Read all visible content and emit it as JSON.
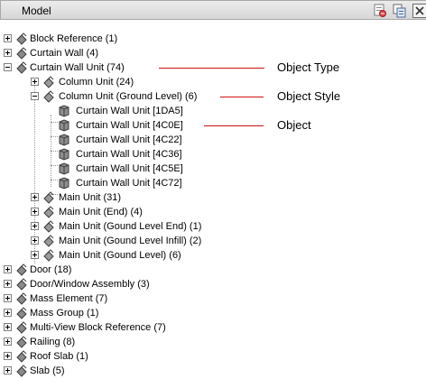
{
  "panel": {
    "title": "Model",
    "toolbar_icons": [
      "filter-icon",
      "copy-icon",
      "close-icon"
    ]
  },
  "tree": {
    "items": [
      {
        "label": "Block Reference (1)",
        "expander": "plus",
        "icon": "object-type-icon"
      },
      {
        "label": "Curtain Wall (4)",
        "expander": "plus",
        "icon": "object-type-icon"
      },
      {
        "label": "Curtain Wall Unit (74)",
        "expander": "minus",
        "icon": "object-type-icon"
      },
      {
        "label": "Column Unit (24)",
        "expander": "plus",
        "icon": "object-style-icon"
      },
      {
        "label": "Column Unit (Ground Level) (6)",
        "expander": "minus",
        "icon": "object-style-icon"
      },
      {
        "label": "Curtain Wall Unit [1DA5]",
        "icon": "object-icon"
      },
      {
        "label": "Curtain Wall Unit [4C0E]",
        "icon": "object-icon"
      },
      {
        "label": "Curtain Wall Unit [4C22]",
        "icon": "object-icon"
      },
      {
        "label": "Curtain Wall Unit [4C36]",
        "icon": "object-icon"
      },
      {
        "label": "Curtain Wall Unit [4C5E]",
        "icon": "object-icon"
      },
      {
        "label": "Curtain Wall Unit [4C72]",
        "icon": "object-icon"
      },
      {
        "label": "Main Unit (31)",
        "expander": "plus",
        "icon": "object-style-icon"
      },
      {
        "label": "Main Unit (End) (4)",
        "expander": "plus",
        "icon": "object-style-icon"
      },
      {
        "label": "Main Unit (Gound Level End) (1)",
        "expander": "plus",
        "icon": "object-style-icon"
      },
      {
        "label": "Main Unit (Gound Level Infill) (2)",
        "expander": "plus",
        "icon": "object-style-icon"
      },
      {
        "label": "Main Unit (Gound Level) (6)",
        "expander": "plus",
        "icon": "object-style-icon"
      },
      {
        "label": "Door (18)",
        "expander": "plus",
        "icon": "object-type-icon"
      },
      {
        "label": "Door/Window Assembly (3)",
        "expander": "plus",
        "icon": "object-type-icon"
      },
      {
        "label": "Mass Element (7)",
        "expander": "plus",
        "icon": "object-type-icon"
      },
      {
        "label": "Mass Group (1)",
        "expander": "plus",
        "icon": "object-type-icon"
      },
      {
        "label": "Multi-View Block Reference (7)",
        "expander": "plus",
        "icon": "object-type-icon"
      },
      {
        "label": "Railing (8)",
        "expander": "plus",
        "icon": "object-type-icon"
      },
      {
        "label": "Roof Slab (1)",
        "expander": "plus",
        "icon": "object-type-icon"
      },
      {
        "label": "Slab (5)",
        "expander": "plus",
        "icon": "object-type-icon"
      }
    ]
  },
  "callouts": {
    "object_type": "Object Type",
    "object_style": "Object Style",
    "object": "Object"
  },
  "colors": {
    "callout_line": "#d01010",
    "titlebar_top": "#ececec",
    "titlebar_bottom": "#d6d6d6"
  }
}
